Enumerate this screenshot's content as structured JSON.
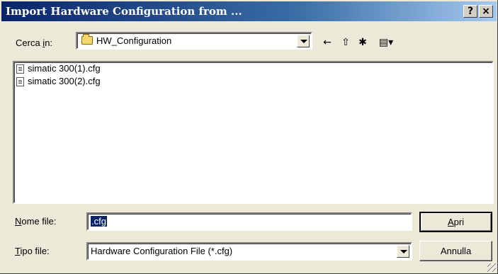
{
  "window": {
    "title": "Import Hardware Configuration from ...",
    "help_label": "?",
    "close_label": "×"
  },
  "look_in": {
    "label_pre": "Cerca ",
    "label_key": "i",
    "label_post": "n:",
    "value": "HW_Configuration"
  },
  "toolbar": {
    "back_icon": "←",
    "up_icon": "⇧",
    "new_folder_icon": "✱",
    "view_icon": "▤▾"
  },
  "files": [
    {
      "name": "simatic 300(1).cfg"
    },
    {
      "name": "simatic 300(2).cfg"
    }
  ],
  "filename": {
    "label_key": "N",
    "label_rest": "ome file:",
    "value": ".cfg"
  },
  "filetype": {
    "label_key": "T",
    "label_rest": "ipo file:",
    "value": "Hardware Configuration File (*.cfg)"
  },
  "buttons": {
    "open_key": "A",
    "open_rest": "pri",
    "cancel": "Annulla"
  }
}
